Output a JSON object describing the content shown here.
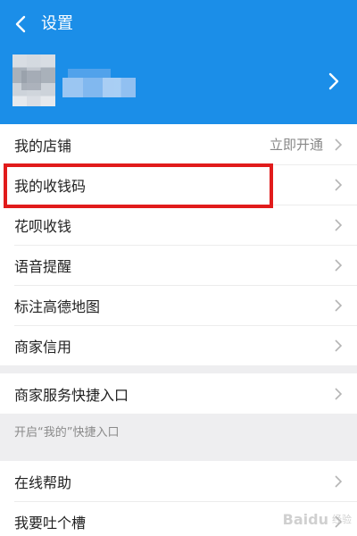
{
  "nav": {
    "title": "设置",
    "back_icon": "chevron-left-icon"
  },
  "profile": {
    "avatar": "blurred-avatar",
    "name": "",
    "arrow_icon": "chevron-right-icon"
  },
  "group1": [
    {
      "label": "我的店铺",
      "value": "立即开通"
    },
    {
      "label": "我的收钱码",
      "value": ""
    },
    {
      "label": "花呗收钱",
      "value": ""
    },
    {
      "label": "语音提醒",
      "value": ""
    },
    {
      "label": "标注高德地图",
      "value": ""
    },
    {
      "label": "商家信用",
      "value": ""
    }
  ],
  "group2": [
    {
      "label": "商家服务快捷入口",
      "value": ""
    }
  ],
  "hint": "开启“我的”快捷入口",
  "group3": [
    {
      "label": "在线帮助",
      "value": ""
    },
    {
      "label": "我要吐个槽",
      "value": ""
    }
  ],
  "colors": {
    "header_bg": "#1b8ee8",
    "highlight": "#e11b1b",
    "page_bg": "#eeeef0"
  },
  "watermark": {
    "text": "Baidu",
    "sub": "经验"
  }
}
